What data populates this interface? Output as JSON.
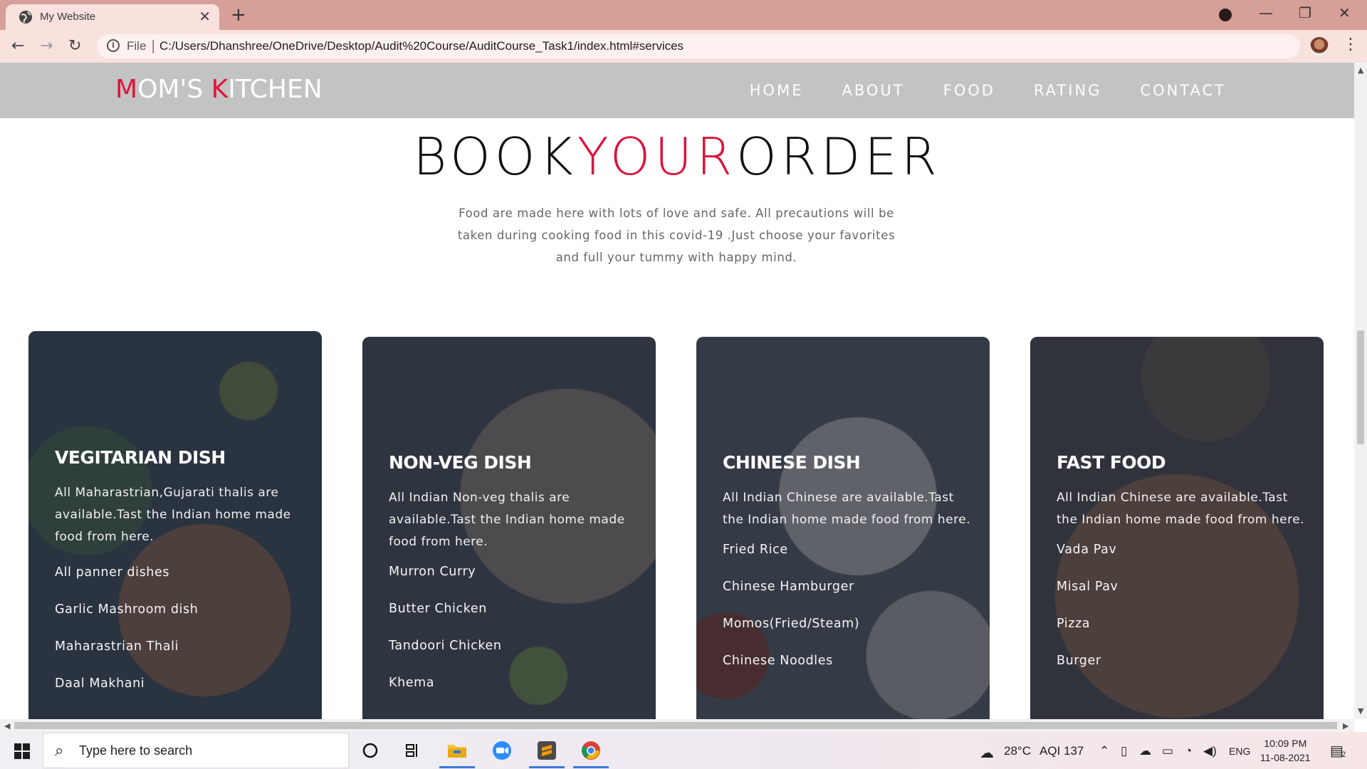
{
  "browser": {
    "tab_title": "My Website",
    "url_scheme": "File",
    "url": "C:/Users/Dhanshree/OneDrive/Desktop/Audit%20Course/AuditCourse_Task1/index.html#services"
  },
  "site": {
    "logo_first_letter": "M",
    "logo_part1": "OM'S ",
    "logo_k": "K",
    "logo_part2": "ITCHEN",
    "nav": [
      "HOME",
      "ABOUT",
      "FOOD",
      "RATING",
      "CONTACT"
    ]
  },
  "section": {
    "title_word1": "BOOK",
    "title_word2": "YOUR",
    "title_word3": "ORDER",
    "description": "Food are made here with lots of love and safe. All precautions will be taken during cooking food in this covid-19 .Just choose your favorites and full your tummy with happy mind."
  },
  "cards": [
    {
      "title": "VEGITARIAN DISH",
      "description": "All Maharastrian,Gujarati thalis are available.Tast the Indian home made food from here.",
      "items": [
        "All panner dishes",
        "Garlic Mashroom dish",
        "Maharastrian Thali",
        "Daal Makhani"
      ]
    },
    {
      "title": "NON-VEG DISH",
      "description": "All Indian Non-veg thalis are available.Tast the Indian home made food from here.",
      "items": [
        "Murron Curry",
        "Butter Chicken",
        "Tandoori Chicken",
        "Khema"
      ]
    },
    {
      "title": "CHINESE DISH",
      "description": "All Indian Chinese are available.Tast the Indian home made food from here.",
      "items": [
        "Fried Rice",
        "Chinese Hamburger",
        "Momos(Fried/Steam)",
        "Chinese Noodles"
      ]
    },
    {
      "title": "FAST FOOD",
      "description": "All Indian Chinese are available.Tast the Indian home made food from here.",
      "items": [
        "Vada Pav",
        "Misal Pav",
        "Pizza",
        "Burger"
      ]
    }
  ],
  "taskbar": {
    "search_placeholder": "Type here to search",
    "temperature": "28°C",
    "aqi": "AQI 137",
    "language": "ENG",
    "time": "10:09 PM",
    "date": "11-08-2021",
    "notification_count": "2"
  },
  "colors": {
    "accent": "#dc143c",
    "header_bg": "#c3c3c3",
    "titlebar_bg": "#d69f97"
  }
}
